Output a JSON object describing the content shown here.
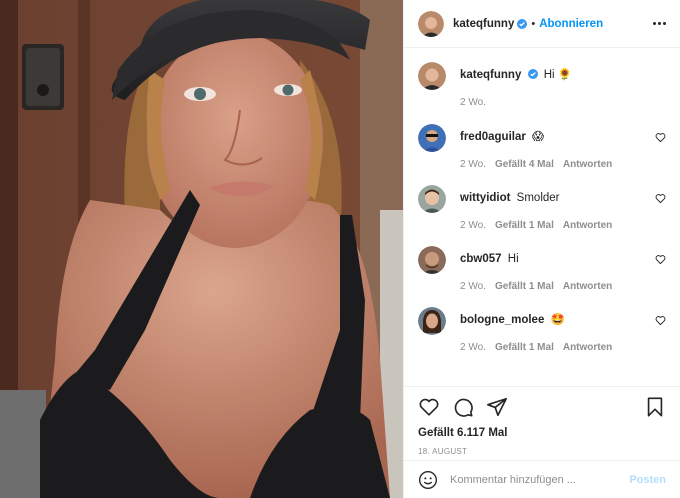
{
  "post": {
    "author": "kateqfunny",
    "follow_label": "Abonnieren",
    "caption": {
      "username": "kateqfunny",
      "text": "Hi 🌻",
      "time": "2 Wo."
    },
    "comments": [
      {
        "username": "fred0aguilar",
        "text": "😱",
        "time": "2 Wo.",
        "likes": "Gefällt 4 Mal",
        "reply": "Antworten"
      },
      {
        "username": "wittyidiot",
        "text": "Smolder",
        "time": "2 Wo.",
        "likes": "Gefällt 1 Mal",
        "reply": "Antworten"
      },
      {
        "username": "cbw057",
        "text": "Hi",
        "time": "2 Wo.",
        "likes": "Gefällt 1 Mal",
        "reply": "Antworten"
      },
      {
        "username": "bologne_molee",
        "text": "🤩",
        "time": "2 Wo.",
        "likes": "Gefällt 1 Mal",
        "reply": "Antworten"
      }
    ],
    "like_count": "Gefällt 6.117 Mal",
    "date": "18. AUGUST",
    "comment_placeholder": "Kommentar hinzufügen ...",
    "post_button": "Posten"
  },
  "colors": {
    "link_blue": "#0095f6",
    "muted_gray": "#8e8e8e",
    "post_disabled": "#b2dffc"
  },
  "icons": [
    "verified-icon",
    "more-options-icon",
    "heart-icon",
    "comment-icon",
    "share-icon",
    "bookmark-icon",
    "emoji-icon"
  ]
}
